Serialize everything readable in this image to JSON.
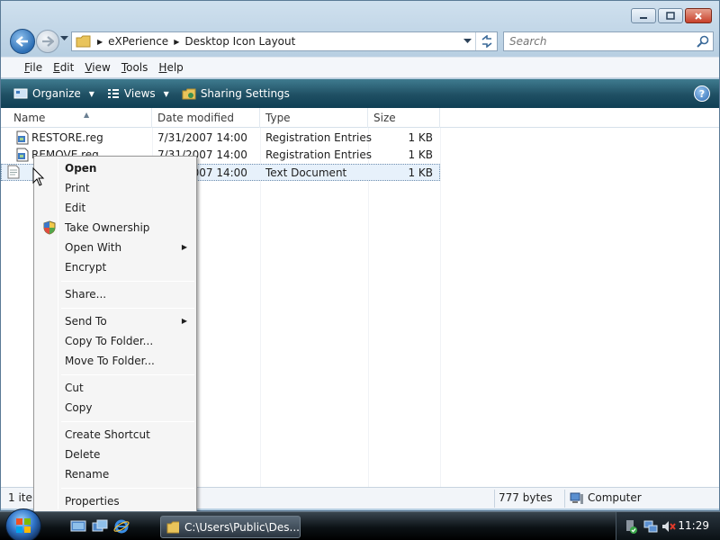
{
  "window": {
    "breadcrumb": [
      "eXPerience",
      "Desktop Icon Layout"
    ],
    "search_placeholder": "Search"
  },
  "menu_bar": [
    {
      "mnemonic": "F",
      "rest": "ile"
    },
    {
      "mnemonic": "E",
      "rest": "dit"
    },
    {
      "mnemonic": "V",
      "rest": "iew"
    },
    {
      "mnemonic": "T",
      "rest": "ools"
    },
    {
      "mnemonic": "H",
      "rest": "elp"
    }
  ],
  "command_bar": {
    "organize": "Organize",
    "views": "Views",
    "sharing": "Sharing Settings",
    "help": "?"
  },
  "columns": {
    "name": "Name",
    "date": "Date modified",
    "type": "Type",
    "size": "Size"
  },
  "files": [
    {
      "name": "RESTORE.reg",
      "date": "7/31/2007 14:00",
      "type": "Registration Entries",
      "size": "1 KB"
    },
    {
      "name": "REMOVE.reg",
      "date": "7/31/2007 14:00",
      "type": "Registration Entries",
      "size": "1 KB"
    },
    {
      "name": "",
      "date": "7/31/2007 14:00",
      "type": "Text Document",
      "size": "1 KB"
    }
  ],
  "status": {
    "items": "1 iter",
    "bytes": "777 bytes",
    "location": "Computer"
  },
  "context_menu": {
    "open": "Open",
    "print": "Print",
    "edit": "Edit",
    "take_ownership": "Take Ownership",
    "open_with": "Open With",
    "encrypt": "Encrypt",
    "share": "Share...",
    "send_to": "Send To",
    "copy_to_folder": "Copy To Folder...",
    "move_to_folder": "Move To Folder...",
    "cut": "Cut",
    "copy": "Copy",
    "create_shortcut": "Create Shortcut",
    "delete": "Delete",
    "rename": "Rename",
    "properties": "Properties"
  },
  "taskbar": {
    "task_button": "C:\\Users\\Public\\Des...",
    "clock": "11:29"
  }
}
